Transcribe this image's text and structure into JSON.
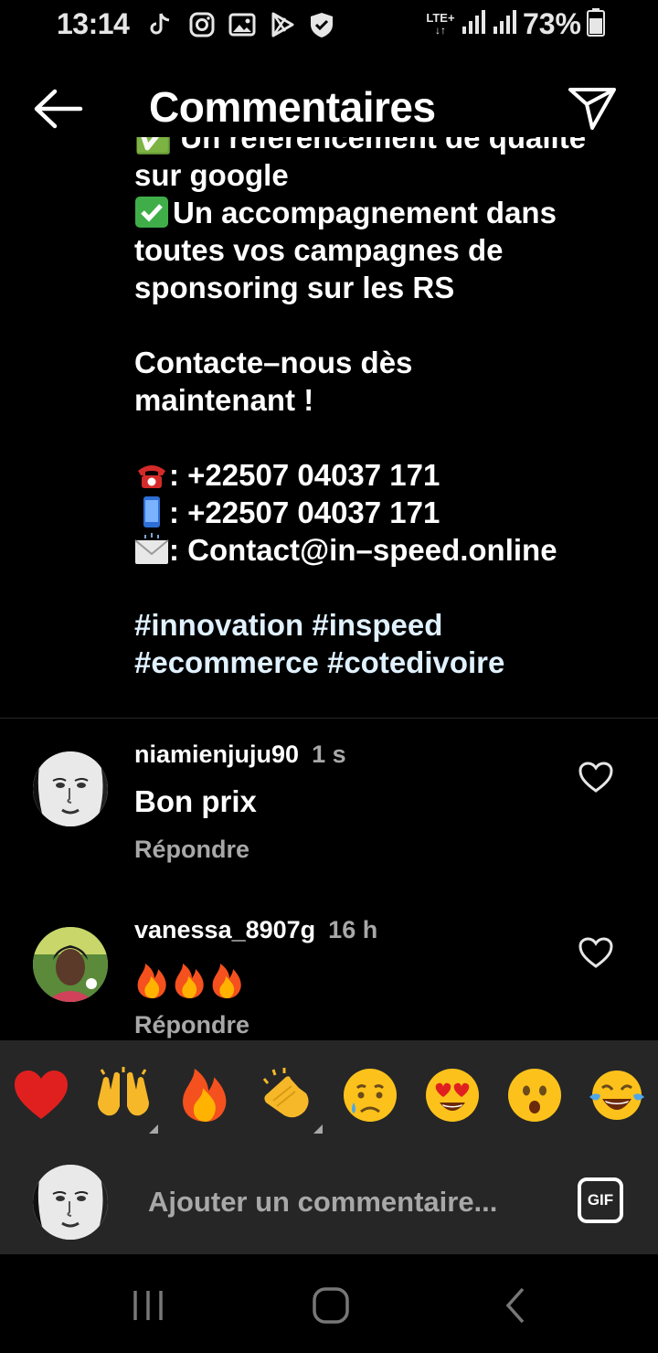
{
  "status_bar": {
    "time": "13:14",
    "network": "LTE+",
    "battery": "73%",
    "icons_left": [
      "tiktok-icon",
      "instagram-icon",
      "gallery-icon",
      "play-store-icon",
      "shield-icon"
    ]
  },
  "header": {
    "title": "Commentaires"
  },
  "caption": {
    "cut_line": "✅ Un référencement de qualité",
    "lines": [
      "sur google",
      "Un accompagnement dans",
      "toutes vos campagnes de",
      "sponsoring sur les RS",
      "",
      "Contacte–nous dès",
      "maintenant !",
      "",
      ": +22507 04037 171",
      ": +22507 04037 171",
      ": Contact@in–speed.online",
      ""
    ],
    "hashtags_line1": "#innovation #inspeed",
    "hashtags_line2": "#ecommerce #cotedivoire"
  },
  "comments": [
    {
      "username": "niamienjuju90",
      "time": "1 s",
      "text": "Bon prix",
      "reply": "Répondre"
    },
    {
      "username": "vanessa_8907g",
      "time": "16 h",
      "text": "🔥🔥🔥",
      "reply": "Répondre"
    }
  ],
  "reactions": [
    "heart",
    "raised-hands",
    "fire",
    "clapping-hands",
    "crying-face",
    "heart-eyes-face",
    "surprised-face",
    "tears-of-joy-face"
  ],
  "input": {
    "placeholder": "Ajouter un commentaire...",
    "gif_label": "GIF"
  },
  "colors": {
    "background": "#000000",
    "secondary_text": "#a8a8a8",
    "panel": "#262626",
    "hashtag": "#e0f1ff"
  }
}
